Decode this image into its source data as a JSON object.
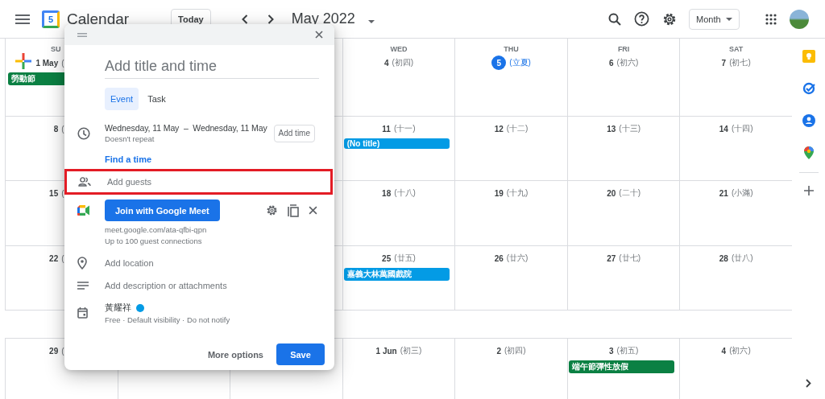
{
  "header": {
    "app_name": "Calendar",
    "logo_day": "5",
    "today_button": "Today",
    "month_title": "May 2022",
    "view_dropdown": "Month"
  },
  "calendar": {
    "weeks": [
      {
        "cells": [
          {
            "weekday": "SU",
            "day": "1 May",
            "lunar": "(",
            "today": false,
            "events": [
              {
                "title": "勞動節",
                "color": "#0b8043"
              }
            ]
          },
          {},
          {},
          {
            "weekday": "WED",
            "day": "4",
            "lunar": "(初四)",
            "today": false
          },
          {
            "weekday": "THU",
            "day": "5",
            "lunar": "(立夏)",
            "today": true
          },
          {
            "weekday": "FRI",
            "day": "6",
            "lunar": "(初六)",
            "today": false
          },
          {
            "weekday": "SAT",
            "day": "7",
            "lunar": "(初七)",
            "today": false
          }
        ]
      },
      {
        "cells": [
          {
            "day": "8",
            "lunar": "(",
            "today": false
          },
          {},
          {},
          {
            "day": "11",
            "lunar": "(十一)",
            "today": false,
            "events": [
              {
                "title": "(No title)",
                "color": "#039be5"
              }
            ]
          },
          {
            "day": "12",
            "lunar": "(十二)",
            "today": false
          },
          {
            "day": "13",
            "lunar": "(十三)",
            "today": false
          },
          {
            "day": "14",
            "lunar": "(十四)",
            "today": false
          }
        ]
      },
      {
        "cells": [
          {
            "day": "15",
            "lunar": "(",
            "today": false
          },
          {},
          {},
          {
            "day": "18",
            "lunar": "(十八)",
            "today": false
          },
          {
            "day": "19",
            "lunar": "(十九)",
            "today": false
          },
          {
            "day": "20",
            "lunar": "(二十)",
            "today": false
          },
          {
            "day": "21",
            "lunar": "(小滿)",
            "today": false
          }
        ]
      },
      {
        "cells": [
          {
            "day": "22",
            "lunar": "(",
            "today": false
          },
          {},
          {},
          {
            "day": "25",
            "lunar": "(廿五)",
            "today": false,
            "events": [
              {
                "title": "嘉義大林萬國戲院",
                "color": "#039be5"
              }
            ]
          },
          {
            "day": "26",
            "lunar": "(廿六)",
            "today": false
          },
          {
            "day": "27",
            "lunar": "(廿七)",
            "today": false
          },
          {
            "day": "28",
            "lunar": "(廿八)",
            "today": false
          }
        ]
      },
      {
        "cells": [
          {
            "day": "29",
            "lunar": "(",
            "today": false
          },
          {},
          {},
          {
            "day": "1 Jun",
            "lunar": "(初三)",
            "today": false
          },
          {
            "day": "2",
            "lunar": "(初四)",
            "today": false
          },
          {
            "day": "3",
            "lunar": "(初五)",
            "today": false,
            "events": [
              {
                "title": "端午節彈性放假",
                "color": "#0b8043"
              }
            ]
          },
          {
            "day": "4",
            "lunar": "(初六)",
            "today": false
          }
        ]
      }
    ]
  },
  "dialog": {
    "title_field": {
      "placeholder": "Add title and time"
    },
    "tabs": [
      {
        "label": "Event",
        "selected": true
      },
      {
        "label": "Task",
        "selected": false
      }
    ],
    "date_range": {
      "start": "Wednesday, 11 May",
      "separator": "–",
      "end": "Wednesday, 11 May",
      "repeat": "Doesn't repeat",
      "add_time_button": "Add time"
    },
    "find_time_link": "Find a time",
    "guests_field": {
      "placeholder": "Add guests",
      "highlighted": true
    },
    "meet": {
      "button": "Join with Google Meet",
      "link": "meet.google.com/ata-qfbi-qpn",
      "capacity": "Up to 100 guest connections"
    },
    "location_field": {
      "placeholder": "Add location"
    },
    "description_field": {
      "placeholder": "Add description or attachments"
    },
    "calendar": {
      "owner": "黃耀祥",
      "color": "#039be5",
      "details": "Free · Default visibility · Do not notify"
    },
    "more_options_button": "More options",
    "save_button": "Save"
  }
}
